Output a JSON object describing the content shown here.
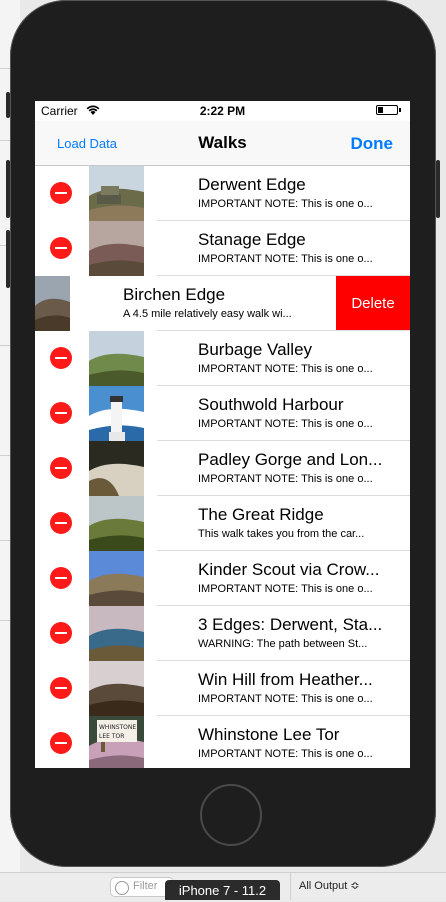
{
  "status": {
    "carrier": "Carrier",
    "time": "2:22 PM",
    "battery_level": 0.3
  },
  "nav": {
    "left": "Load Data",
    "title": "Walks",
    "right": "Done"
  },
  "rows": [
    {
      "title": "Derwent Edge",
      "subtitle": "IMPORTANT NOTE: This is one o...",
      "mode": "edit",
      "thumb": "rock-tor",
      "colors": [
        "#c9d6e0",
        "#6b6b4a",
        "#8c7a5a"
      ]
    },
    {
      "title": "Stanage Edge",
      "subtitle": "IMPORTANT NOTE: This is one o...",
      "mode": "edit",
      "thumb": "edge-moor",
      "colors": [
        "#b7a6a0",
        "#7b5b55",
        "#5a4a3a"
      ]
    },
    {
      "title": "Birchen Edge",
      "subtitle": "A 4.5 mile relatively easy walk wi...",
      "mode": "swiped",
      "delete_label": "Delete",
      "thumb": "heather",
      "colors": [
        "#9aa5b0",
        "#6a5a4a",
        "#4a3a2a"
      ]
    },
    {
      "title": "Burbage Valley",
      "subtitle": "IMPORTANT NOTE: This is one o...",
      "mode": "edit",
      "thumb": "valley",
      "colors": [
        "#c5d2de",
        "#6f8a4a",
        "#4a5a2a"
      ]
    },
    {
      "title": "Southwold Harbour",
      "subtitle": "IMPORTANT NOTE: This is one o...",
      "mode": "edit",
      "thumb": "lighthouse",
      "colors": [
        "#4a8fd0",
        "#ffffff",
        "#2a6aa8"
      ]
    },
    {
      "title": "Padley Gorge and Lon...",
      "subtitle": "IMPORTANT NOTE: This is one o...",
      "mode": "edit",
      "thumb": "waterfall",
      "colors": [
        "#2a2a20",
        "#d8d0c0",
        "#6a5a3a"
      ]
    },
    {
      "title": "The Great Ridge",
      "subtitle": "This walk takes you from the car...",
      "mode": "edit",
      "thumb": "ridge",
      "colors": [
        "#bcc6c8",
        "#6a7a3a",
        "#3a4a1a"
      ]
    },
    {
      "title": "Kinder Scout via Crow...",
      "subtitle": "IMPORTANT NOTE: This is one o...",
      "mode": "edit",
      "thumb": "kinder",
      "colors": [
        "#5a8ad8",
        "#8a7a5a",
        "#5a4a3a"
      ]
    },
    {
      "title": "3 Edges: Derwent, Sta...",
      "subtitle": "WARNING: The path between St...",
      "mode": "edit",
      "thumb": "reservoir",
      "colors": [
        "#c8b8c0",
        "#3a6a8a",
        "#6a5a3a"
      ]
    },
    {
      "title": "Win Hill from Heather...",
      "subtitle": "IMPORTANT NOTE: This is one o...",
      "mode": "edit",
      "thumb": "winhill",
      "colors": [
        "#d8d0d0",
        "#5a4a3a",
        "#3a2a1a"
      ]
    },
    {
      "title": "Whinstone Lee Tor",
      "subtitle": "IMPORTANT NOTE: This is one o...",
      "mode": "edit",
      "thumb": "signpost",
      "sign_text": "WHINSTONE LEE TOR",
      "colors": [
        "#3a4a3a",
        "#c8a0b8",
        "#8a6a7a"
      ]
    }
  ],
  "xcode": {
    "filter_placeholder": "Filter",
    "device": "iPhone 7 - 11.2",
    "output_menu": "All Output ≎"
  }
}
